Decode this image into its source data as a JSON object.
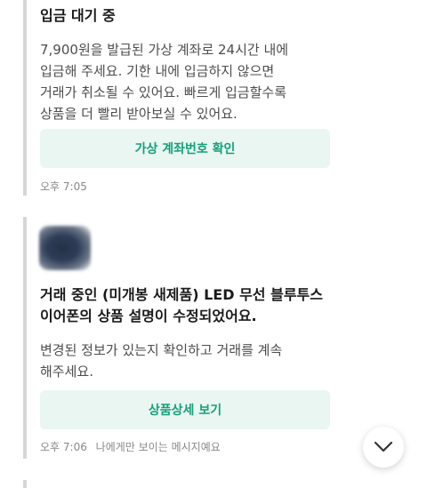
{
  "messages": [
    {
      "title": "입금 대기 중",
      "body_lines": [
        "7,900원을 발급된 가상 계좌로 24시간 내에",
        "입금해 주세요. 기한 내에 입금하지 않으면",
        "거래가 취소될 수 있어요. 빠르게 입금할수록",
        "상품을 더 빨리 받아보실 수 있어요."
      ],
      "button_label": "가상 계좌번호 확인",
      "timestamp": "오후 7:05"
    },
    {
      "title_lines": [
        "거래 중인 (미개봉 새제품) LED 무선 블루투스",
        "이어폰의 상품 설명이 수정되었어요."
      ],
      "body_lines": [
        "변경된 정보가 있는지 확인하고 거래를 계속",
        "해주세요."
      ],
      "button_label": "상품상세 보기",
      "timestamp": "오후 7:06",
      "note": "나에게만 보이는 메시지예요"
    }
  ],
  "icons": {
    "scroll_down": "chevron-down-icon",
    "thumbnail": "product-thumbnail"
  },
  "colors": {
    "accent": "#15a07a",
    "button_bg": "#eaf6f2",
    "divider": "#d6d6d6"
  }
}
